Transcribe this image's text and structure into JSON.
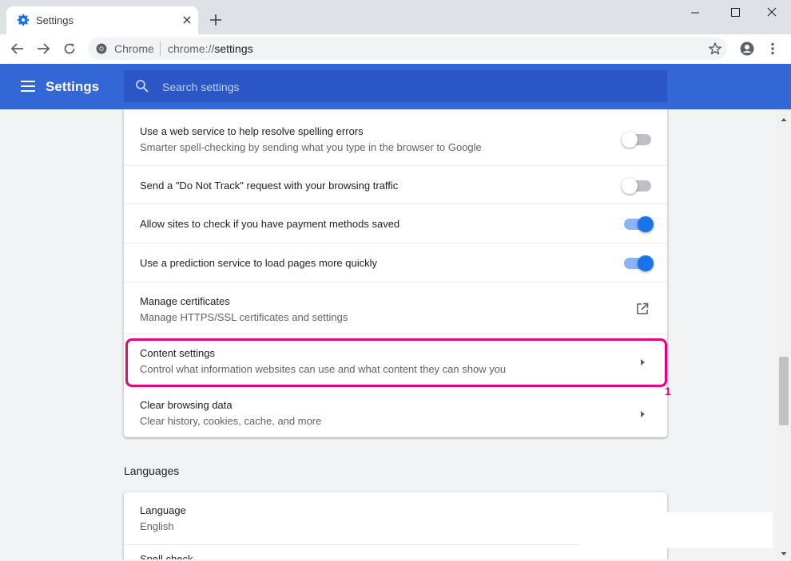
{
  "browser": {
    "tab_title": "Settings",
    "omnibox_chip": "Chrome",
    "url_scheme": "chrome://",
    "url_path": "settings"
  },
  "header": {
    "title": "Settings",
    "search_placeholder": "Search settings"
  },
  "rows": [
    {
      "title": "Use a web service to help resolve spelling errors",
      "subtitle": "Smarter spell-checking by sending what you type in the browser to Google",
      "control": "toggle",
      "checked": false
    },
    {
      "title": "Send a \"Do Not Track\" request with your browsing traffic",
      "control": "toggle",
      "checked": false
    },
    {
      "title": "Allow sites to check if you have payment methods saved",
      "control": "toggle",
      "checked": true
    },
    {
      "title": "Use a prediction service to load pages more quickly",
      "control": "toggle",
      "checked": true
    },
    {
      "title": "Manage certificates",
      "subtitle": "Manage HTTPS/SSL certificates and settings",
      "control": "launch"
    },
    {
      "title": "Content settings",
      "subtitle": "Control what information websites can use and what content they can show you",
      "control": "arrow"
    },
    {
      "title": "Clear browsing data",
      "subtitle": "Clear history, cookies, cache, and more",
      "control": "arrow"
    }
  ],
  "annotation": {
    "marker": "1",
    "color": "#e6007e"
  },
  "languages": {
    "section_title": "Languages",
    "language_label": "Language",
    "language_value": "English",
    "next_row_partial": "Spell check"
  },
  "colors": {
    "header_blue": "#3367d6",
    "toggle_on": "#1a73e8",
    "highlight": "#e6007e"
  }
}
